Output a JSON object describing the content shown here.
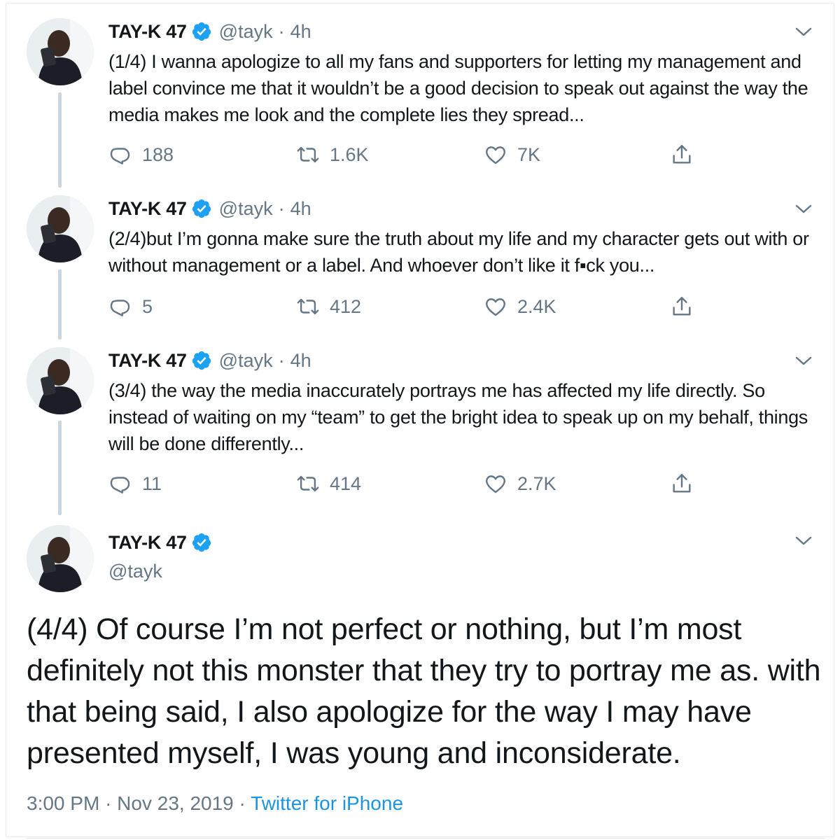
{
  "tweets": [
    {
      "name": "TAY-K 47",
      "handle": "@tayk",
      "separator": "·",
      "time": "4h",
      "text": "(1/4) I wanna apologize to all my fans and supporters for letting my management and label convince me that it wouldn’t be a good decision to speak out against the way the media makes me look and the complete lies they spread...",
      "replies": "188",
      "retweets": "1.6K",
      "likes": "7K"
    },
    {
      "name": "TAY-K 47",
      "handle": "@tayk",
      "separator": "·",
      "time": "4h",
      "text": "(2/4)but I’m gonna make sure the truth about my life and my character gets out with or without management or a label. And whoever don’t like it f▪ck you...",
      "replies": "5",
      "retweets": "412",
      "likes": "2.4K"
    },
    {
      "name": "TAY-K 47",
      "handle": "@tayk",
      "separator": "·",
      "time": "4h",
      "text": "(3/4) the way the media inaccurately portrays me has affected my life directly. So instead of waiting on my “team” to get the bright idea to speak up on my behalf, things will be done differently...",
      "replies": "11",
      "retweets": "414",
      "likes": "2.7K"
    }
  ],
  "main_tweet": {
    "name": "TAY-K 47",
    "handle": "@tayk",
    "text": "(4/4) Of course I’m not perfect or nothing, but I’m most definitely not this monster that they try to portray me as. with that being said, I also apologize for the way I may have presented myself, I was young and inconsiderate.",
    "time": "3:00 PM",
    "date": "Nov 23, 2019",
    "separator": "·",
    "source": "Twitter for iPhone"
  },
  "icons": {
    "verified": "verified-badge-icon",
    "reply": "reply-icon",
    "retweet": "retweet-icon",
    "like": "heart-icon",
    "share": "share-icon",
    "more": "chevron-down-icon"
  },
  "colors": {
    "verified_blue": "#1da1f2",
    "link_blue": "#1b95e0",
    "secondary_text": "#657786",
    "thread_line": "#ccd6dd"
  }
}
